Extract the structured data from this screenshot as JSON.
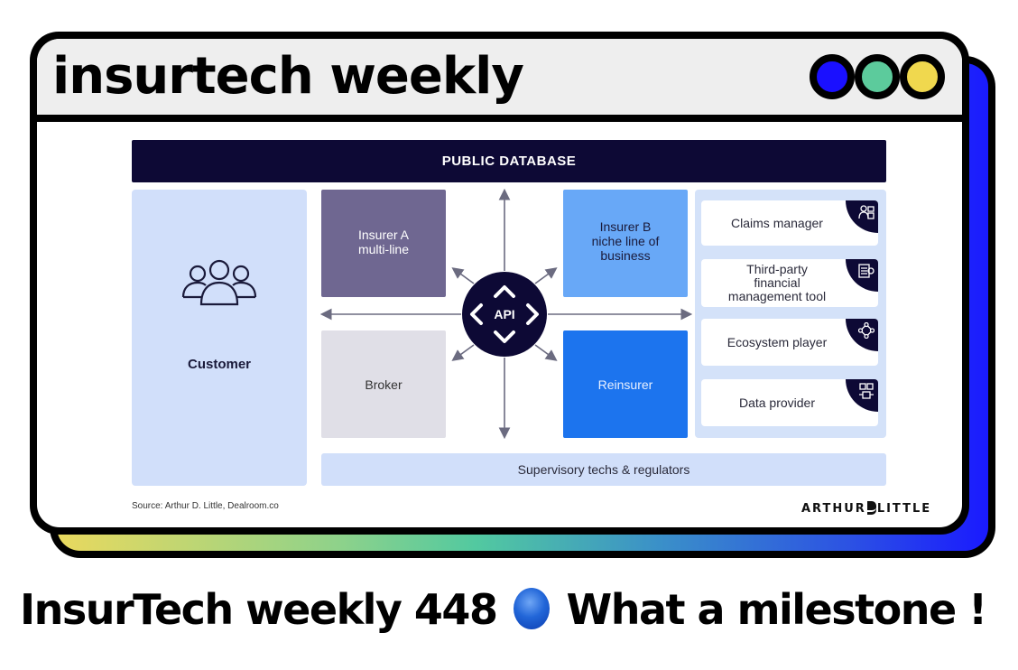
{
  "header": {
    "site_title": "insurtech weekly",
    "window_dots": [
      {
        "name": "blue",
        "color": "#1a10ff"
      },
      {
        "name": "green",
        "color": "#5ccb9c"
      },
      {
        "name": "yellow",
        "color": "#f0d84e"
      }
    ]
  },
  "diagram": {
    "top_bar": "PUBLIC DATABASE",
    "customer": {
      "label": "Customer",
      "icon": "group-of-people-icon"
    },
    "insurer_a": {
      "line1": "Insurer A",
      "line2": "multi-line"
    },
    "broker": "Broker",
    "insurer_b": {
      "line1": "Insurer B",
      "line2": "niche line of",
      "line3": "business"
    },
    "reinsurer": "Reinsurer",
    "api_hub": "API",
    "partners": [
      {
        "lines": [
          "Claims manager"
        ],
        "icon": "claims-manager-icon"
      },
      {
        "lines": [
          "Third-party",
          "financial",
          "management tool"
        ],
        "icon": "calculator-gear-icon"
      },
      {
        "lines": [
          "Ecosystem player"
        ],
        "icon": "network-nodes-icon"
      },
      {
        "lines": [
          "Data provider"
        ],
        "icon": "data-documents-icon"
      }
    ],
    "bottom_bar": "Supervisory techs & regulators",
    "source": "Source: Arthur D. Little, Dealroom.co",
    "logo": {
      "left": "ARTHUR",
      "right": "LITTLE"
    }
  },
  "caption": {
    "before": "InsurTech weekly 448",
    "after": "What a milestone !"
  },
  "colors": {
    "navy": "#0d0935",
    "customer_bg": "#d1dffa",
    "insurer_a_bg": "#6f6791",
    "broker_bg": "#e0dfe7",
    "insurer_b_bg": "#68a8f7",
    "reinsurer_bg": "#1c74ee",
    "arrow": "#6b6b80"
  }
}
